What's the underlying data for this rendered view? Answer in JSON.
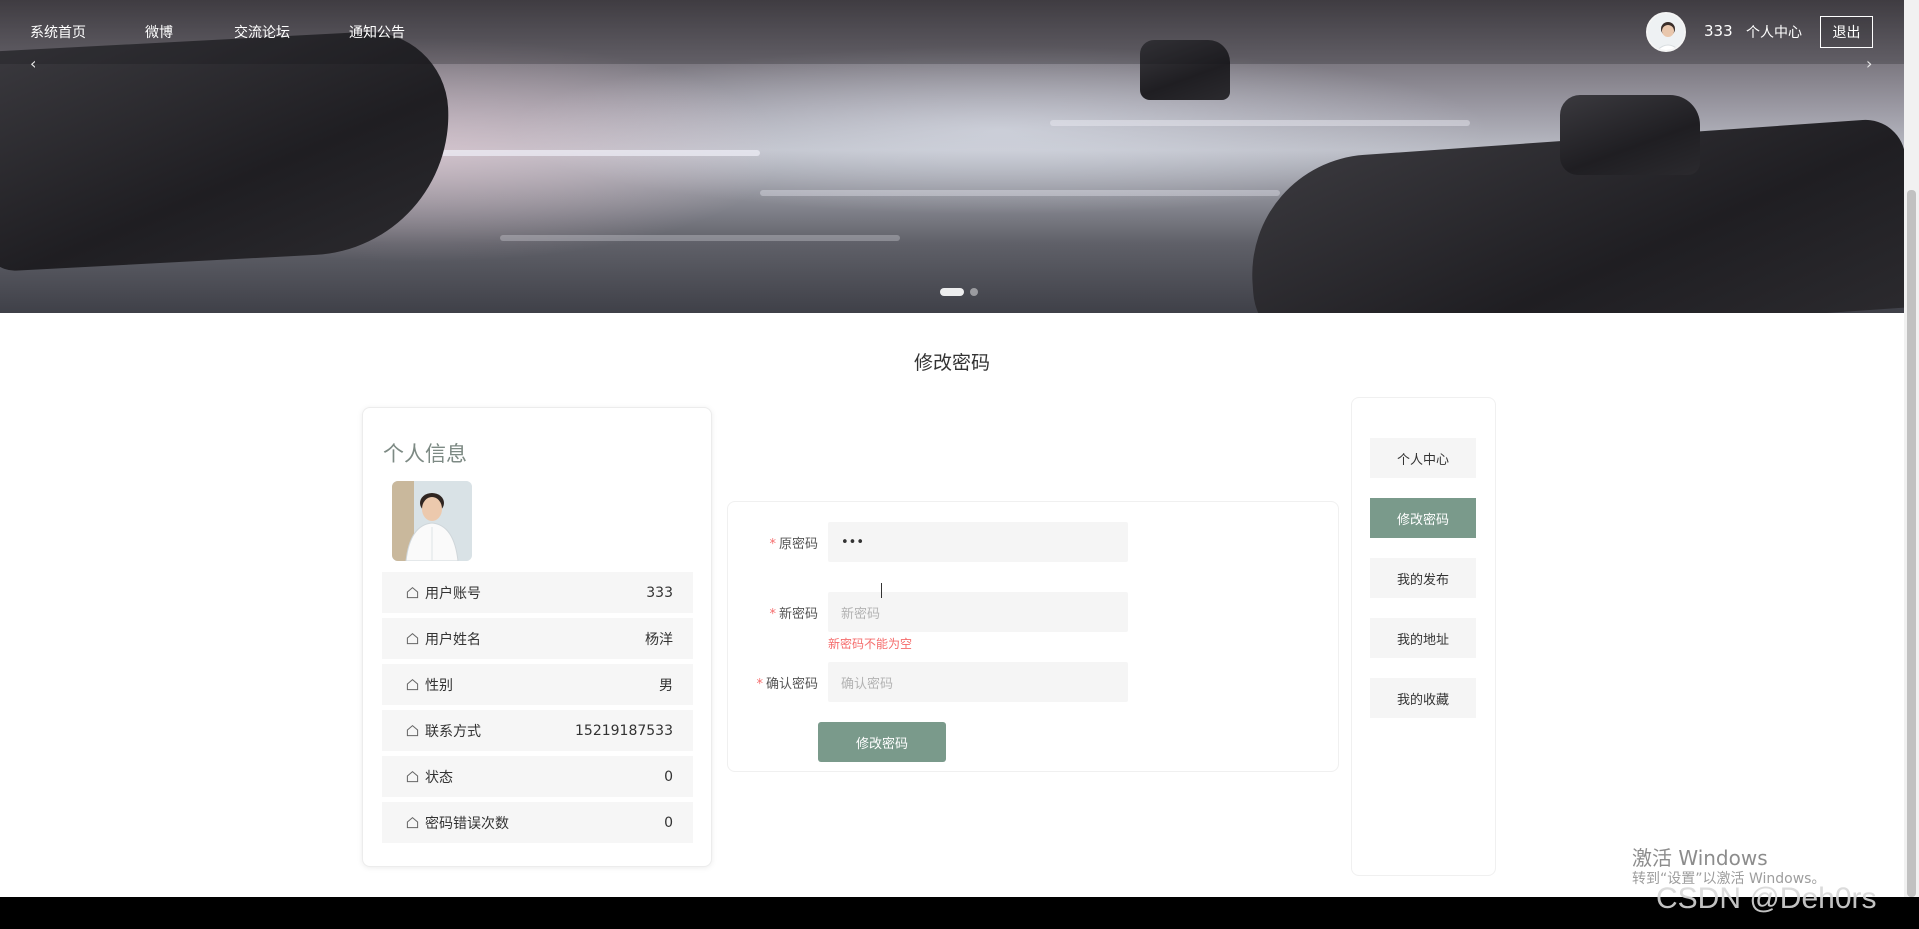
{
  "nav": {
    "items": [
      "系统首页",
      "微博",
      "交流论坛",
      "通知公告"
    ],
    "user_name": "333",
    "personal_center": "个人中心",
    "logout": "退出",
    "prev_arrow": "‹",
    "next_arrow": "›"
  },
  "page": {
    "title": "修改密码"
  },
  "info": {
    "title": "个人信息",
    "rows": [
      {
        "label": "用户账号",
        "value": "333"
      },
      {
        "label": "用户姓名",
        "value": "杨洋"
      },
      {
        "label": "性别",
        "value": "男"
      },
      {
        "label": "联系方式",
        "value": "15219187533"
      },
      {
        "label": "状态",
        "value": "0"
      },
      {
        "label": "密码错误次数",
        "value": "0"
      }
    ]
  },
  "form": {
    "required_mark": "*",
    "old_password_label": "原密码",
    "old_password_value": "•••",
    "new_password_label": "新密码",
    "new_password_placeholder": "新密码",
    "new_password_error": "新密码不能为空",
    "confirm_password_label": "确认密码",
    "confirm_password_placeholder": "确认密码",
    "submit_label": "修改密码"
  },
  "menu": {
    "items": [
      "个人中心",
      "修改密码",
      "我的发布",
      "我的地址",
      "我的收藏"
    ],
    "active_index": 1
  },
  "watermark": {
    "activate_title": "激活 Windows",
    "activate_sub": "转到“设置”以激活 Windows。",
    "csdn": "CSDN @Deh0rs"
  },
  "colors": {
    "accent": "#7a9a8b",
    "error": "#f56c6c"
  }
}
